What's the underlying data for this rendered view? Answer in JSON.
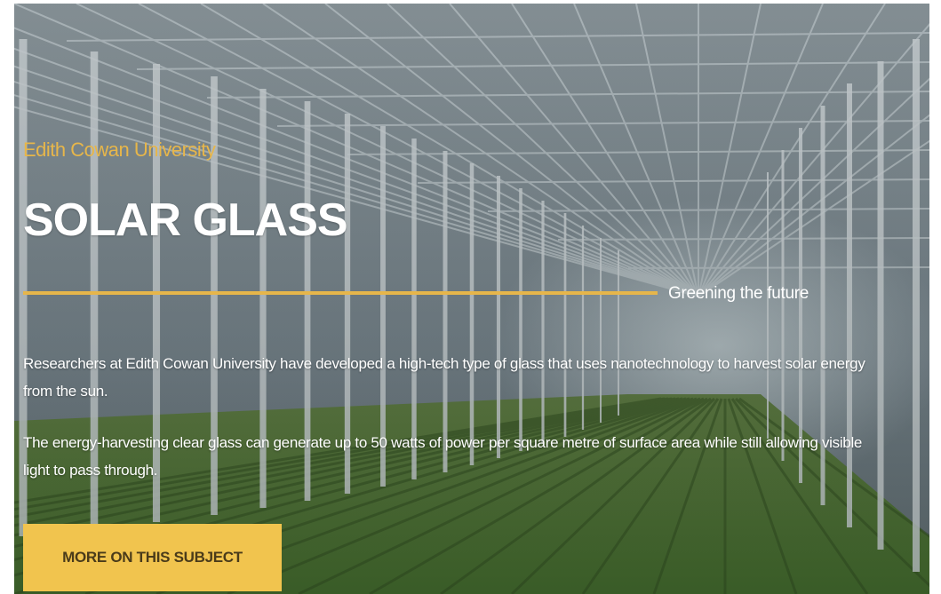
{
  "hero": {
    "eyebrow": "Edith Cowan University",
    "title": "SOLAR GLASS",
    "tagline": "Greening the future",
    "paragraphs": [
      "Researchers at Edith Cowan University have developed a high-tech type of glass that uses nanotechnology to harvest solar energy from the sun.",
      "The energy-harvesting clear glass can generate up to 50 watts of power per square metre of surface area while still allowing visible light to pass through."
    ],
    "cta_label": "MORE ON THIS SUBJECT"
  },
  "colors": {
    "accent": "#e7b64a",
    "button_bg": "#f1c44e",
    "text": "#ffffff",
    "button_text": "#4a3b1a"
  },
  "background_image": "greenhouse-photo"
}
